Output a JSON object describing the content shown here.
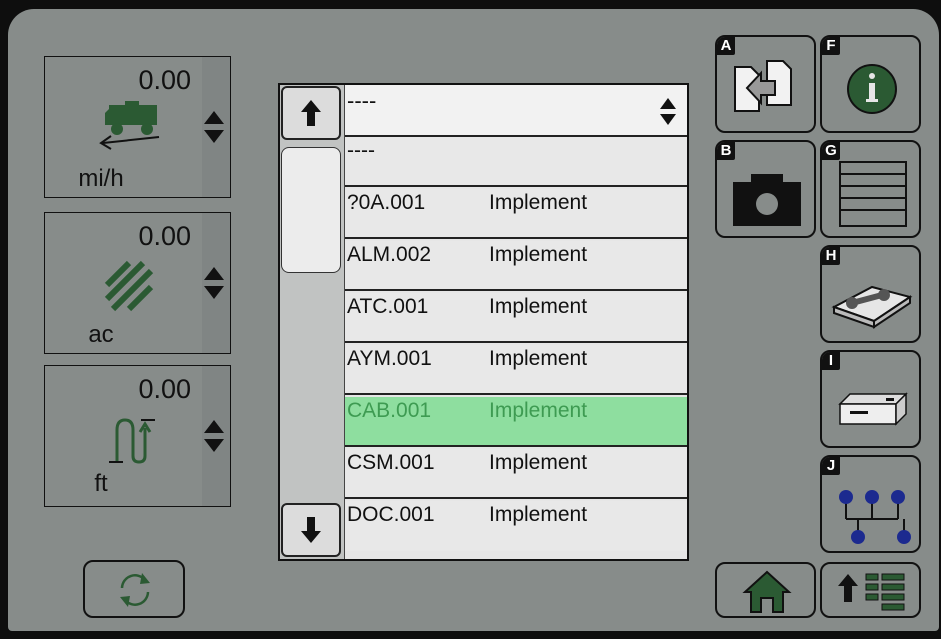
{
  "gauges": [
    {
      "value": "0.00",
      "unit": "mi/h",
      "icon": "tractor-speed-icon"
    },
    {
      "value": "0.00",
      "unit": "ac",
      "icon": "area-hatch-icon"
    },
    {
      "value": "0.00",
      "unit": "ft",
      "icon": "distance-path-icon"
    }
  ],
  "list": {
    "header": "----",
    "rows": [
      {
        "code": "----",
        "kind": ""
      },
      {
        "code": "?0A.001",
        "kind": "Implement"
      },
      {
        "code": "ALM.002",
        "kind": "Implement"
      },
      {
        "code": "ATC.001",
        "kind": "Implement"
      },
      {
        "code": "AYM.001",
        "kind": "Implement"
      },
      {
        "code": "CAB.001",
        "kind": "Implement",
        "selected": true
      },
      {
        "code": "CSM.001",
        "kind": "Implement"
      },
      {
        "code": "DOC.001",
        "kind": "Implement"
      }
    ]
  },
  "side_buttons": {
    "A": {
      "letter": "A",
      "icon": "file-transfer-icon"
    },
    "B": {
      "letter": "B",
      "icon": "camera-icon"
    },
    "F": {
      "letter": "F",
      "icon": "info-icon"
    },
    "G": {
      "letter": "G",
      "icon": "list-lines-icon"
    },
    "H": {
      "letter": "H",
      "icon": "manual-wrench-icon"
    },
    "I": {
      "letter": "I",
      "icon": "controller-box-icon"
    },
    "J": {
      "letter": "J",
      "icon": "network-nodes-icon"
    }
  },
  "colors": {
    "screen_bg": "#878c8a",
    "accent_green": "#2b5a33",
    "selected_row": "#8ede9f"
  }
}
